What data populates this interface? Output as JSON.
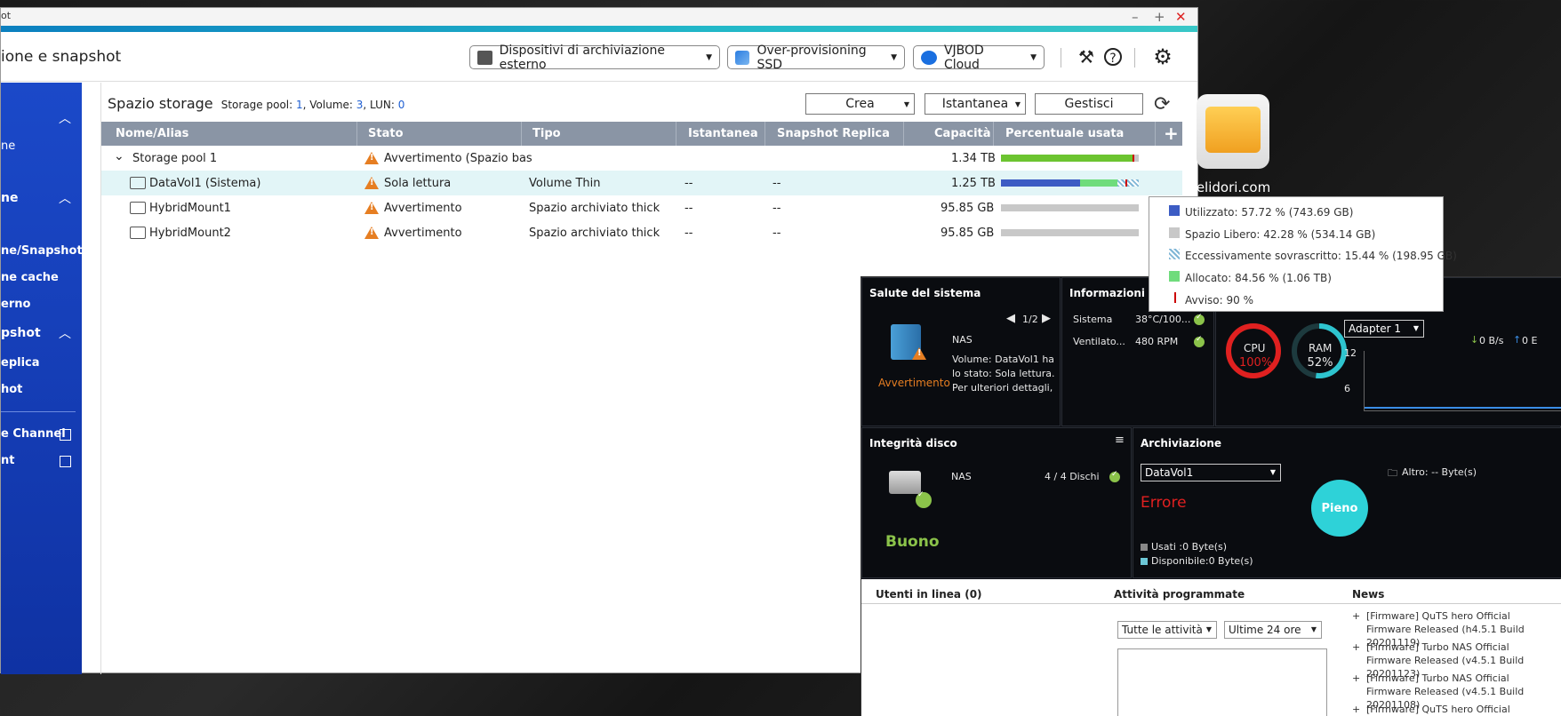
{
  "window": {
    "title_fragment": "ot",
    "app_title": "ione e snapshot",
    "header_buttons": [
      {
        "label": "Dispositivi di archiviazione esterno"
      },
      {
        "label": "Over-provisioning SSD"
      },
      {
        "label": "VJBOD Cloud"
      }
    ]
  },
  "sidebar": {
    "items": [
      "ne",
      "ne",
      "ne/Snapshot",
      "ne cache",
      "erno",
      "pshot",
      "eplica",
      "hot",
      "e Channel",
      "nt"
    ]
  },
  "storage": {
    "title": "Spazio storage",
    "pool_label": "Storage pool:",
    "pool_count": "1",
    "volume_label": ", Volume:",
    "volume_count": "3",
    "lun_label": ", LUN:",
    "lun_count": "0",
    "buttons": {
      "create": "Crea",
      "snapshot": "Istantanea",
      "manage": "Gestisci"
    },
    "columns": [
      "Nome/Alias",
      "Stato",
      "Tipo",
      "Istantanea",
      "Snapshot Replica",
      "Capacità",
      "Percentuale usata"
    ],
    "rows": [
      {
        "name": "Storage pool 1",
        "status": "Avvertimento (Spazio bas",
        "type": "",
        "snapshot": "",
        "replica": "",
        "capacity": "1.34 TB",
        "used": 0.9
      },
      {
        "name": "DataVol1 (Sistema)",
        "status": "Sola lettura",
        "type": "Volume Thin",
        "snapshot": "--",
        "replica": "--",
        "capacity": "1.25 TB",
        "used": 0.8456
      },
      {
        "name": "HybridMount1",
        "status": "Avvertimento",
        "type": "Spazio archiviato thick",
        "snapshot": "--",
        "replica": "--",
        "capacity": "95.85 GB",
        "used": 0
      },
      {
        "name": "HybridMount2",
        "status": "Avvertimento",
        "type": "Spazio archiviato thick",
        "snapshot": "--",
        "replica": "--",
        "capacity": "95.85 GB",
        "used": 0
      }
    ]
  },
  "desktop": {
    "icon_label": "selidori.com"
  },
  "tooltip": {
    "lines": [
      {
        "text": "Utilizzato: 57.72 % (743.69 GB)",
        "color": "#3c5cc4"
      },
      {
        "text": "Spazio Libero: 42.28 % (534.14 GB)",
        "color": "#c8c8c8"
      },
      {
        "text": "Eccessivamente sovrascritto: 15.44 % (198.95 GB)",
        "color": "#7fb6d6"
      },
      {
        "text": "Allocato: 84.56 % (1.06 TB)",
        "color": "#6fdc7c"
      },
      {
        "text": "Avviso: 90 %",
        "color": "#cc0000"
      }
    ]
  },
  "dashboard": {
    "health": {
      "title": "Salute del sistema",
      "pager": "1/2",
      "device": "NAS",
      "status": "Avvertimento",
      "message": "Volume: DataVol1 ha lo stato: Sola lettura. Per ulteriori dettagli,"
    },
    "hardware": {
      "title": "Informazioni hard",
      "system_label": "Sistema",
      "system_value": "38°C/100...",
      "fan_label": "Ventilato...",
      "fan_value": "480 RPM"
    },
    "resource": {
      "cpu_label": "CPU",
      "cpu_value": "100%",
      "ram_label": "RAM",
      "ram_value": "52%",
      "cpu_pct": 100,
      "ram_pct": 52
    },
    "network": {
      "adapter": "Adapter 1",
      "down": "0 B/s",
      "up": "0 E",
      "y_top": "12",
      "y_mid": "6"
    },
    "disk": {
      "title": "Integrità disco",
      "device": "NAS",
      "disks": "4 / 4 Dischi",
      "status": "Buono"
    },
    "archive": {
      "title": "Archiviazione",
      "volume": "DataVol1",
      "other": "Altro: -- Byte(s)",
      "state": "Errore",
      "full": "Pieno",
      "used": "Usati :0 Byte(s)",
      "available": "Disponibile:0 Byte(s)"
    },
    "users": {
      "title": "Utenti in linea (0)"
    },
    "tasks": {
      "title": "Attività programmate",
      "filter": "Tutte le attività",
      "range": "Ultime 24 ore"
    },
    "news": {
      "title": "News",
      "items": [
        "[Firmware] QuTS hero Official Firmware Released (h4.5.1 Build 20201119)",
        "[Firmware] Turbo NAS Official Firmware Released (v4.5.1 Build 20201123)",
        "[Firmware] Turbo NAS Official Firmware Released (v4.5.1 Build 20201108)",
        "[Firmware] QuTS hero Official Firmware"
      ]
    }
  },
  "colors": {
    "accent": "#1b49c9",
    "warning": "#e67e22",
    "ok": "#8bc34a",
    "cpu": "#e02020",
    "ram": "#2ec4cf",
    "full": "#2ed2d8"
  }
}
